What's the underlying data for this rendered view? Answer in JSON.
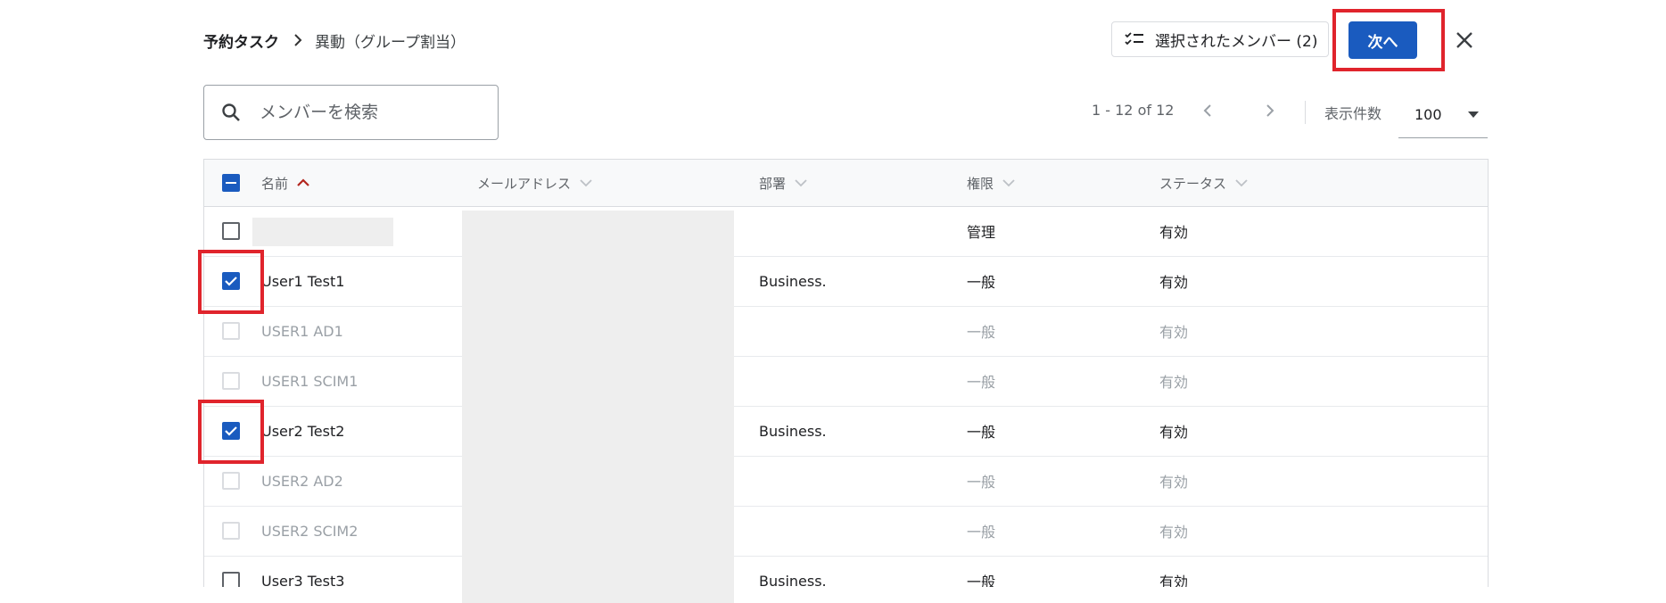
{
  "breadcrumb": {
    "parent": "予約タスク",
    "current": "異動（グループ割当）"
  },
  "header": {
    "selected_members_label": "選択されたメンバー (2)",
    "next_label": "次へ"
  },
  "search": {
    "placeholder": "メンバーを検索",
    "value": ""
  },
  "pagination": {
    "range": "1 - 12 of 12",
    "per_page_label": "表示件数",
    "per_page_value": "100"
  },
  "table": {
    "columns": [
      {
        "label": "名前",
        "sort": "ascending"
      },
      {
        "label": "メールアドレス",
        "sort": "none"
      },
      {
        "label": "部署",
        "sort": "none"
      },
      {
        "label": "権限",
        "sort": "none"
      },
      {
        "label": "ステータス",
        "sort": "none"
      }
    ],
    "rows": [
      {
        "name": "",
        "email": "",
        "dept": "",
        "role": "管理",
        "status": "有効",
        "checked": false,
        "disabled": false
      },
      {
        "name": "User1 Test1",
        "email": "",
        "dept": "Business.",
        "role": "一般",
        "status": "有効",
        "checked": true,
        "disabled": false
      },
      {
        "name": "USER1 AD1",
        "email": "",
        "dept": "",
        "role": "一般",
        "status": "有効",
        "checked": false,
        "disabled": true
      },
      {
        "name": "USER1 SCIM1",
        "email": "",
        "dept": "",
        "role": "一般",
        "status": "有効",
        "checked": false,
        "disabled": true
      },
      {
        "name": "User2 Test2",
        "email": "",
        "dept": "Business.",
        "role": "一般",
        "status": "有効",
        "checked": true,
        "disabled": false
      },
      {
        "name": "USER2 AD2",
        "email": "",
        "dept": "",
        "role": "一般",
        "status": "有効",
        "checked": false,
        "disabled": true
      },
      {
        "name": "USER2 SCIM2",
        "email": "",
        "dept": "",
        "role": "一般",
        "status": "有効",
        "checked": false,
        "disabled": true
      },
      {
        "name": "User3 Test3",
        "email": "",
        "dept": "Business.",
        "role": "一般",
        "status": "有効",
        "checked": false,
        "disabled": false
      }
    ]
  },
  "colors": {
    "primary": "#1a5bbf",
    "highlight": "#e0242c",
    "sort_active": "#b3261e"
  },
  "icons": [
    "chevron-right-icon",
    "checklist-icon",
    "close-icon",
    "search-icon",
    "chevron-left-icon",
    "dropdown-arrow-icon",
    "sort-up-icon",
    "sort-down-icon"
  ]
}
